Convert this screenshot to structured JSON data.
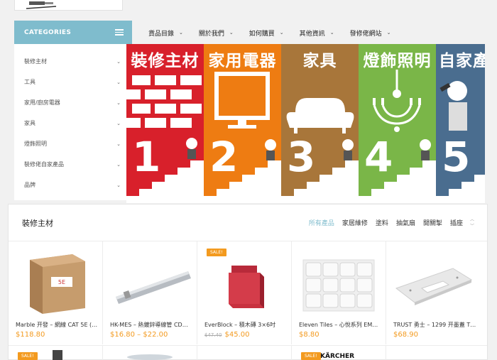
{
  "nav": {
    "items": [
      {
        "label": "貨品目錄"
      },
      {
        "label": "關於我們"
      },
      {
        "label": "如何購買"
      },
      {
        "label": "其他資訊"
      },
      {
        "label": "發修佬網站"
      }
    ]
  },
  "categories": {
    "title": "CATEGORIES",
    "items": [
      {
        "label": "裝修主材"
      },
      {
        "label": "工具"
      },
      {
        "label": "家用/廚房電器"
      },
      {
        "label": "家具"
      },
      {
        "label": "燈飾照明"
      },
      {
        "label": "裝修佬自家產品"
      },
      {
        "label": "品牌"
      }
    ]
  },
  "banner": {
    "panels": [
      {
        "title": "裝修主材",
        "number": "1",
        "color": "#d8202b"
      },
      {
        "title": "家用電器",
        "number": "2",
        "color": "#ee7c12"
      },
      {
        "title": "家具",
        "number": "3",
        "color": "#a8763a"
      },
      {
        "title": "燈飾照明",
        "number": "4",
        "color": "#7ab648"
      },
      {
        "title": "自家產",
        "number": "5",
        "color": "#4a6d8f"
      }
    ]
  },
  "products": {
    "title": "裝修主材",
    "tabs": [
      {
        "label": "所有產品",
        "active": true
      },
      {
        "label": "家居維修",
        "active": false
      },
      {
        "label": "塗料",
        "active": false
      },
      {
        "label": "抽氣扇",
        "active": false
      },
      {
        "label": "開關掣",
        "active": false
      },
      {
        "label": "插座",
        "active": false
      }
    ],
    "items": [
      {
        "name": "Marble 开發 – 網線 CAT 5E (…",
        "price": "$118.80",
        "old_price": "",
        "sale": ""
      },
      {
        "name": "HK-MES – 熱鍍鋅導線管 CD…",
        "price": "$16.80 – $22.00",
        "old_price": "",
        "sale": ""
      },
      {
        "name": "EverBlock – 積木磚 3×6吋",
        "price": "$45.00",
        "old_price": "$47.40",
        "sale": "SALE!"
      },
      {
        "name": "Eleven Tiles – 心悅系列 EM…",
        "price": "$8.80",
        "old_price": "",
        "sale": ""
      },
      {
        "name": "TRUST 勇士 – 1299 开墨蓋 T…",
        "price": "$68.90",
        "old_price": "",
        "sale": ""
      }
    ],
    "row2": [
      {
        "sale": "SALE!"
      },
      {
        "sale": ""
      },
      {
        "sale": ""
      },
      {
        "sale": "SALE!",
        "brand": "KÄRCHER"
      },
      {
        "sale": ""
      }
    ]
  }
}
